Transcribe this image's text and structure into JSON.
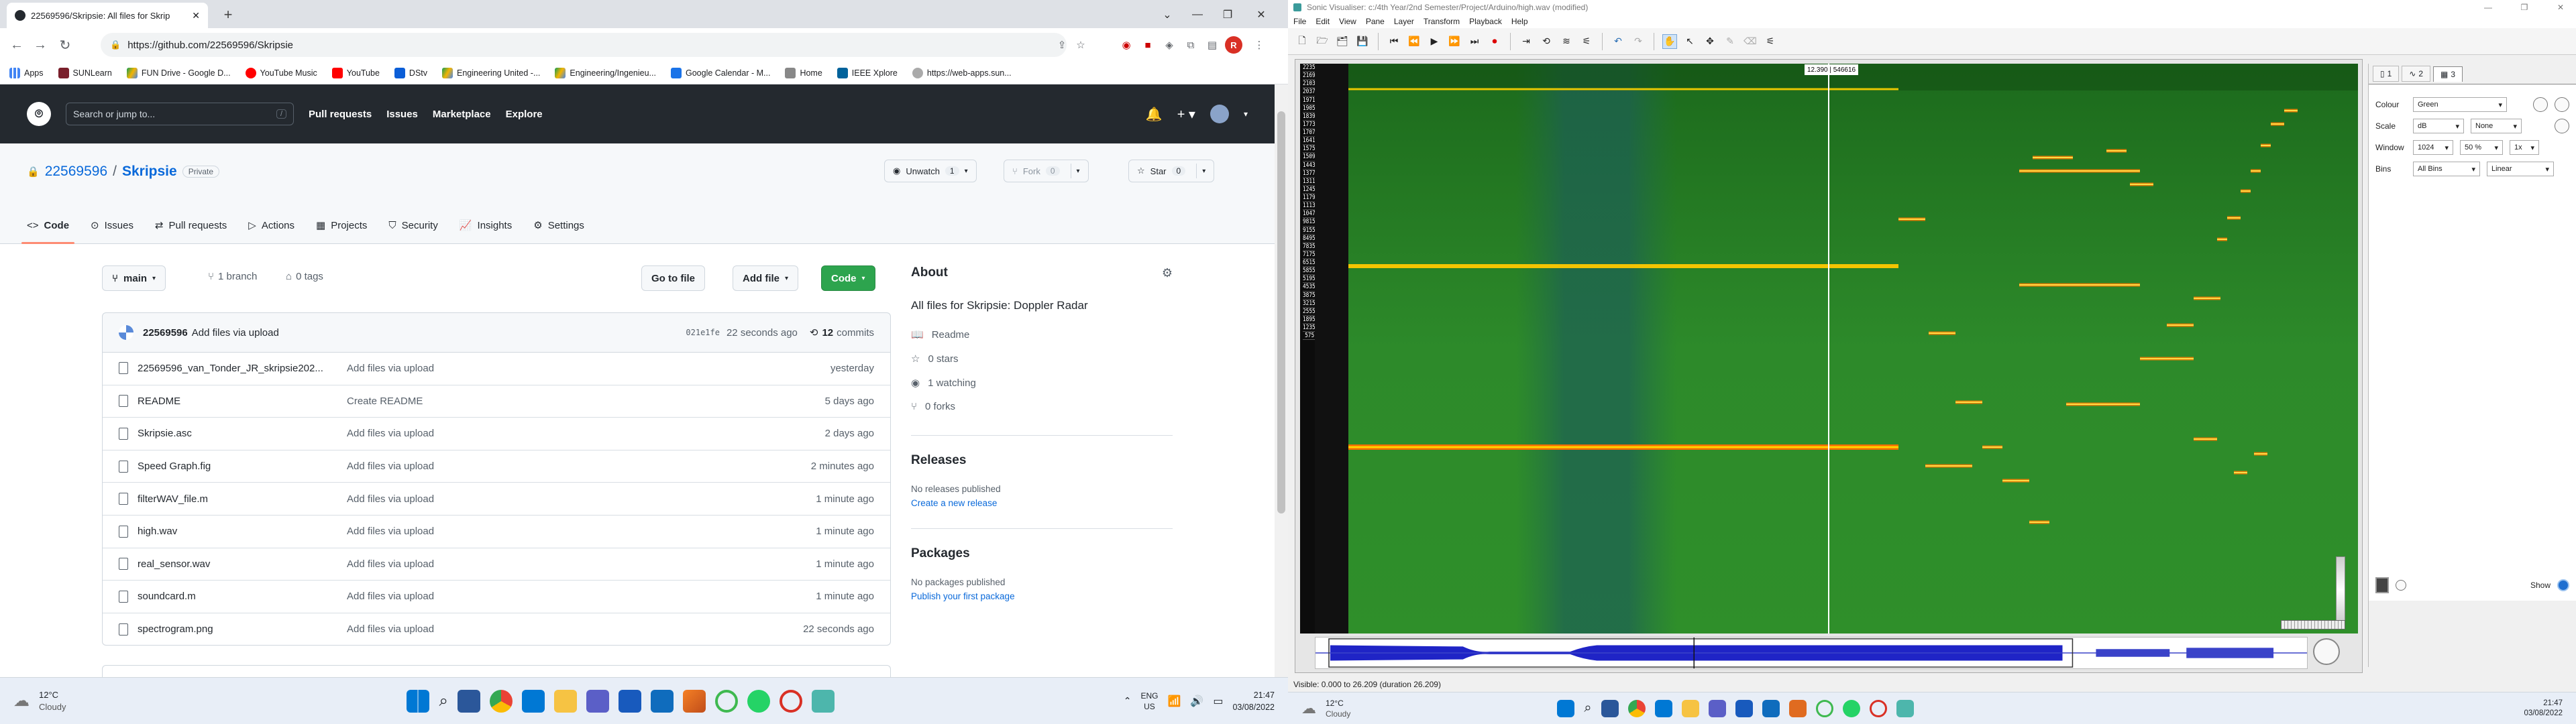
{
  "chrome": {
    "tab_title": "22569596/Skripsie: All files for Skrip",
    "url": "https://github.com/22569596/Skripsie",
    "profile_letter": "R",
    "bookmarks": [
      "Apps",
      "SUNLearn",
      "FUN Drive - Google D...",
      "YouTube Music",
      "YouTube",
      "DStv",
      "Engineering United -...",
      "Engineering/Ingenieu...",
      "Google Calendar - M...",
      "Home",
      "IEEE Xplore",
      "https://web-apps.sun..."
    ]
  },
  "github": {
    "search_placeholder": "Search or jump to...",
    "search_key": "/",
    "nav": [
      "Pull requests",
      "Issues",
      "Marketplace",
      "Explore"
    ],
    "owner": "22569596",
    "separator": "/",
    "repo": "Skripsie",
    "visibility": "Private",
    "unwatch_label": "Unwatch",
    "unwatch_count": "1",
    "fork_label": "Fork",
    "fork_count": "0",
    "star_label": "Star",
    "star_count": "0",
    "tabs": [
      "Code",
      "Issues",
      "Pull requests",
      "Actions",
      "Projects",
      "Security",
      "Insights",
      "Settings"
    ],
    "branch": "main",
    "branches": "1 branch",
    "tags": "0 tags",
    "goto_file": "Go to file",
    "add_file": "Add file",
    "code_button": "Code",
    "commit_author": "22569596",
    "commit_message": "Add files via upload",
    "commit_hash": "021e1fe",
    "commit_time": "22 seconds ago",
    "commits_count": "12",
    "commits_label": "commits",
    "files": [
      {
        "name": "22569596_van_Tonder_JR_skripsie202...",
        "message": "Add files via upload",
        "date": "yesterday"
      },
      {
        "name": "README",
        "message": "Create README",
        "date": "5 days ago"
      },
      {
        "name": "Skripsie.asc",
        "message": "Add files via upload",
        "date": "2 days ago"
      },
      {
        "name": "Speed Graph.fig",
        "message": "Add files via upload",
        "date": "2 minutes ago"
      },
      {
        "name": "filterWAV_file.m",
        "message": "Add files via upload",
        "date": "1 minute ago"
      },
      {
        "name": "high.wav",
        "message": "Add files via upload",
        "date": "1 minute ago"
      },
      {
        "name": "real_sensor.wav",
        "message": "Add files via upload",
        "date": "1 minute ago"
      },
      {
        "name": "soundcard.m",
        "message": "Add files via upload",
        "date": "1 minute ago"
      },
      {
        "name": "spectrogram.png",
        "message": "Add files via upload",
        "date": "22 seconds ago"
      }
    ],
    "about_title": "About",
    "about_desc": "All files for Skripsie: Doppler Radar",
    "about_items": [
      "Readme",
      "0 stars",
      "1 watching",
      "0 forks"
    ],
    "releases_title": "Releases",
    "releases_none": "No releases published",
    "releases_link": "Create a new release",
    "packages_title": "Packages",
    "packages_none": "No packages published",
    "packages_link": "Publish your first package"
  },
  "taskbar_left": {
    "weather_temp": "12°C",
    "weather_desc": "Cloudy",
    "lang_line1": "ENG",
    "lang_line2": "US",
    "time": "21:47",
    "date": "03/08/2022"
  },
  "sonic": {
    "title": "Sonic Visualiser: c:/4th Year/2nd Semester/Project/Arduino/high.wav (modified)",
    "menu": [
      "File",
      "Edit",
      "View",
      "Pane",
      "Layer",
      "Transform",
      "Playback",
      "Help"
    ],
    "cursor_label": "12.390 | 546616",
    "ruler_labels": [
      "22355",
      "21695",
      "21035",
      "20375",
      "19715",
      "19055",
      "18395",
      "17735",
      "17075",
      "16415",
      "15755",
      "15095",
      "14435",
      "13775",
      "13115",
      "12455",
      "11795",
      "11135",
      "10475",
      "9815",
      "9155",
      "8495",
      "7835",
      "7175",
      "6515",
      "5855",
      "5195",
      "4535",
      "3875",
      "3215",
      "2555",
      "1895",
      "1235",
      "575"
    ],
    "status": "Visible: 0.000 to 26.209 (duration 26.209)",
    "prop_tabs": [
      "1",
      "2",
      "3"
    ],
    "props": [
      {
        "label": "Colour",
        "value": "Green"
      },
      {
        "label": "Scale",
        "value": "dB",
        "value2": "None"
      },
      {
        "label": "Window",
        "value": "1024",
        "value2": "50 %",
        "value3": "1x"
      },
      {
        "label": "Bins",
        "value": "All Bins",
        "value2": "Linear"
      }
    ],
    "show_label": "Show"
  },
  "taskbar_right": {
    "weather_temp": "12°C",
    "weather_desc": "Cloudy",
    "time": "21:47",
    "date": "03/08/2022"
  }
}
